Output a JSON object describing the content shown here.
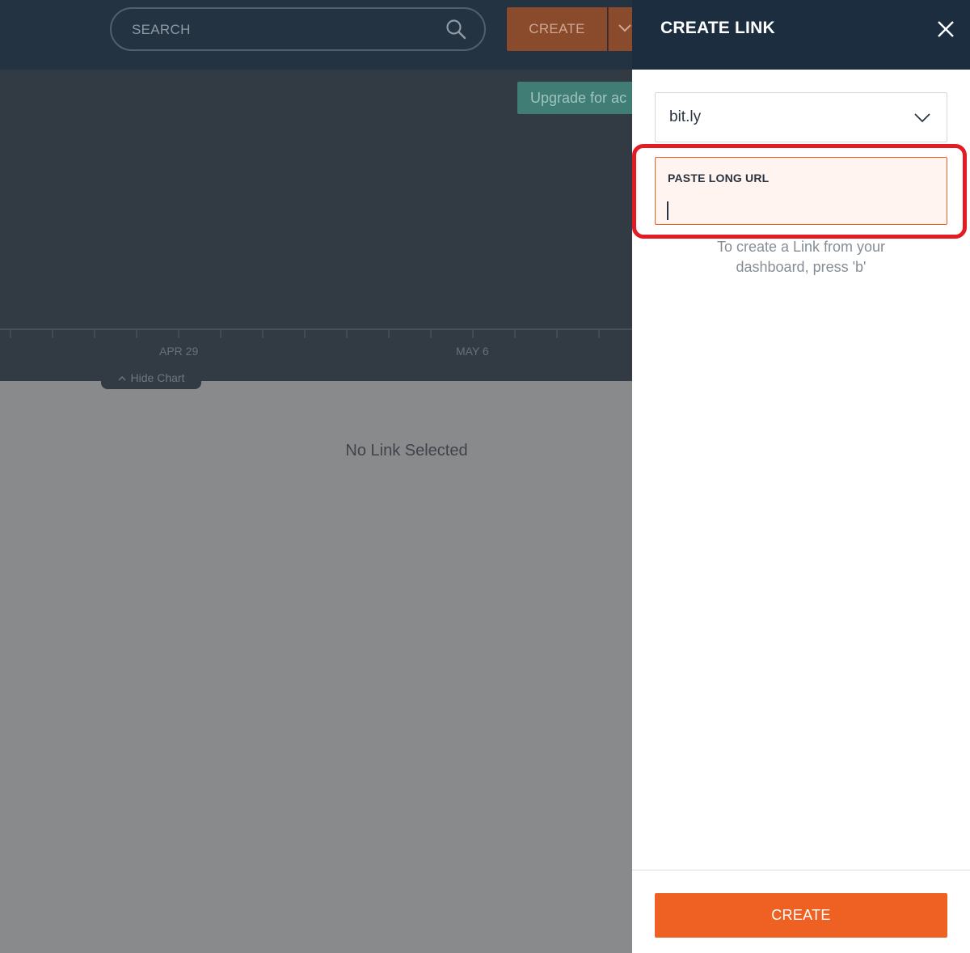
{
  "header": {
    "search_placeholder": "SEARCH",
    "create_label": "CREATE"
  },
  "chart": {
    "upgrade_label": "Upgrade for ac",
    "x_labels": [
      "APR 29",
      "MAY 6"
    ],
    "hide_chart_label": "Hide Chart"
  },
  "main": {
    "empty_state": "No Link Selected"
  },
  "panel": {
    "title": "CREATE LINK",
    "domain_value": "bit.ly",
    "url_label": "PASTE LONG URL",
    "url_value": "",
    "hint_line1": "To create a Link from your",
    "hint_line2": "dashboard, press 'b'",
    "create_label": "CREATE"
  },
  "colors": {
    "brand_orange": "#ee6123",
    "header_navy": "#1c2d3f",
    "highlight_red": "#e31b23"
  },
  "icons": [
    "search-icon",
    "chevron-down-icon",
    "close-icon",
    "chevron-up-icon"
  ]
}
